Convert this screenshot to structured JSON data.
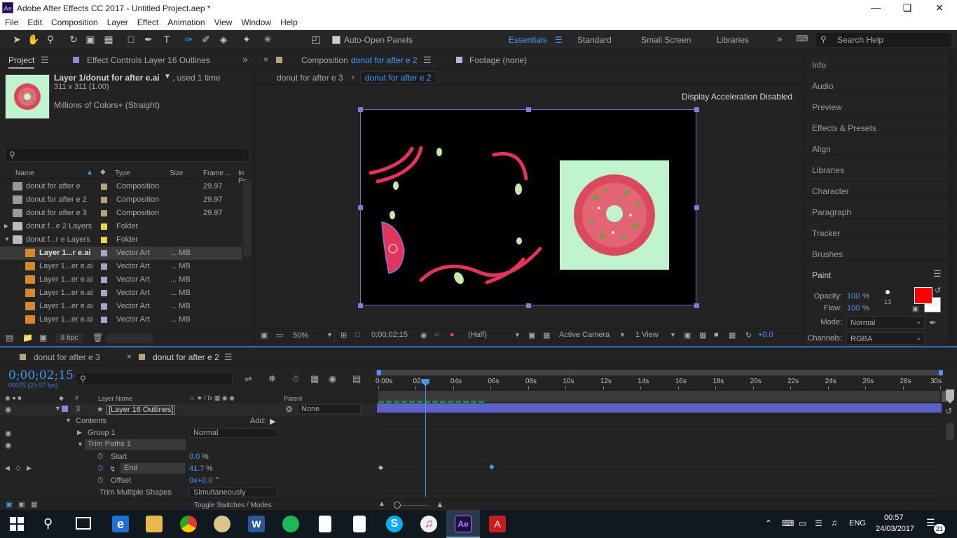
{
  "window": {
    "title": "Adobe After Effects CC 2017 - Untitled Project.aep *",
    "app_badge": "Ae"
  },
  "menu": [
    "File",
    "Edit",
    "Composition",
    "Layer",
    "Effect",
    "Animation",
    "View",
    "Window",
    "Help"
  ],
  "toolbar": {
    "auto_open": "Auto-Open Panels",
    "workspaces": [
      "Essentials",
      "Standard",
      "Small Screen",
      "Libraries"
    ],
    "search_placeholder": "Search Help",
    "active_workspace": "Essentials"
  },
  "project_panel": {
    "tab_project": "Project",
    "tab_effect_controls": "Effect Controls Layer 16 Outlines",
    "item_name": "Layer 1/donut for after e.ai",
    "used": ", used 1 time",
    "dims": "311 x 311 (1.00)",
    "colors": "Millions of Colors+ (Straight)",
    "columns": {
      "name": "Name",
      "type": "Type",
      "size": "Size",
      "frame": "Frame ...",
      "inpoint": "In Po"
    },
    "rows": [
      {
        "name": "donut for after e",
        "type": "Composition",
        "size": "",
        "frame": "29.97",
        "color": "#b4a57d"
      },
      {
        "name": "donut for after e 2",
        "type": "Composition",
        "size": "",
        "frame": "29.97",
        "color": "#b4a57d"
      },
      {
        "name": "donut for after e 3",
        "type": "Composition",
        "size": "",
        "frame": "29.97",
        "color": "#b4a57d"
      },
      {
        "name": "donut f...e 2 Layers",
        "type": "Folder",
        "size": "",
        "frame": "",
        "color": "#e6d84a"
      },
      {
        "name": "donut f...r e Layers",
        "type": "Folder",
        "size": "",
        "frame": "",
        "color": "#e6d84a"
      },
      {
        "name": "Layer 1...r e.ai",
        "type": "Vector Art",
        "size": "... MB",
        "frame": "",
        "color": "#a8a3c8"
      },
      {
        "name": "Layer 1...er e.ai",
        "type": "Vector Art",
        "size": "... MB",
        "frame": "",
        "color": "#a8a3c8"
      },
      {
        "name": "Layer 1...er e.ai",
        "type": "Vector Art",
        "size": "... MB",
        "frame": "",
        "color": "#a8a3c8"
      },
      {
        "name": "Layer 1...er e.ai",
        "type": "Vector Art",
        "size": "... MB",
        "frame": "",
        "color": "#a8a3c8"
      },
      {
        "name": "Layer 1...er e.ai",
        "type": "Vector Art",
        "size": "... MB",
        "frame": "",
        "color": "#a8a3c8"
      },
      {
        "name": "Layer 1...er e.ai",
        "type": "Vector Art",
        "size": "... MB",
        "frame": "",
        "color": "#a8a3c8"
      }
    ],
    "bpc": "8 bpc"
  },
  "comp_panel": {
    "tab": "Composition",
    "comp_name": "donut for after e 2",
    "footage_tab": "Footage (none)",
    "breadcrumb_1": "donut for after e 3",
    "breadcrumb_2": "donut for after e 2",
    "notice": "Display Acceleration Disabled",
    "zoom": "50%",
    "timecode": "0;00;02;15",
    "resolution": "(Half)",
    "camera": "Active Camera",
    "views": "1 View",
    "exposure": "+0.0"
  },
  "right_panel": {
    "items": [
      "Info",
      "Audio",
      "Preview",
      "Effects & Presets",
      "Align",
      "Libraries",
      "Character",
      "Paragraph",
      "Tracker",
      "Brushes"
    ],
    "paint_title": "Paint",
    "opacity_label": "Opacity:",
    "opacity_value": "100",
    "pct": "%",
    "flow_label": "Flow:",
    "flow_value": "100",
    "brush_size": "13",
    "mode_label": "Mode:",
    "mode_value": "Normal",
    "channels_label": "Channels:",
    "channels_value": "RGBA",
    "fg_color": "#ff0000"
  },
  "timeline": {
    "tab_1": "donut for after e 3",
    "tab_2": "donut for after e 2",
    "timecode": "0;00;02;15",
    "frame_info": "00075 (29.97 fps)",
    "col_layer_name": "Layer Name",
    "col_parent": "Parent",
    "layer_num": "3",
    "layer_name": "[Layer 16 Outlines]",
    "parent_value": "None",
    "contents": "Contents",
    "add": "Add:",
    "group1": "Group 1",
    "group1_mode": "Normal",
    "trim_paths": "Trim Paths 1",
    "start_label": "Start",
    "start_value": "0.0",
    "start_unit": "%",
    "end_label": "End",
    "end_value": "41.7",
    "end_unit": "%",
    "offset_label": "Offset",
    "offset_value": "0x+0.0",
    "offset_unit": "°",
    "trim_multi_label": "Trim Multiple Shapes",
    "trim_multi_value": "Simultaneously",
    "toggle": "Toggle Switches / Modes",
    "ruler": [
      "0:00s",
      "02s",
      "04s",
      "06s",
      "08s",
      "10s",
      "12s",
      "14s",
      "16s",
      "18s",
      "20s",
      "22s",
      "24s",
      "26s",
      "28s",
      "30s"
    ],
    "playhead_seconds": 2.5
  },
  "taskbar": {
    "lang": "ENG",
    "time": "00:57",
    "date": "24/03/2017",
    "notif_count": "21"
  }
}
